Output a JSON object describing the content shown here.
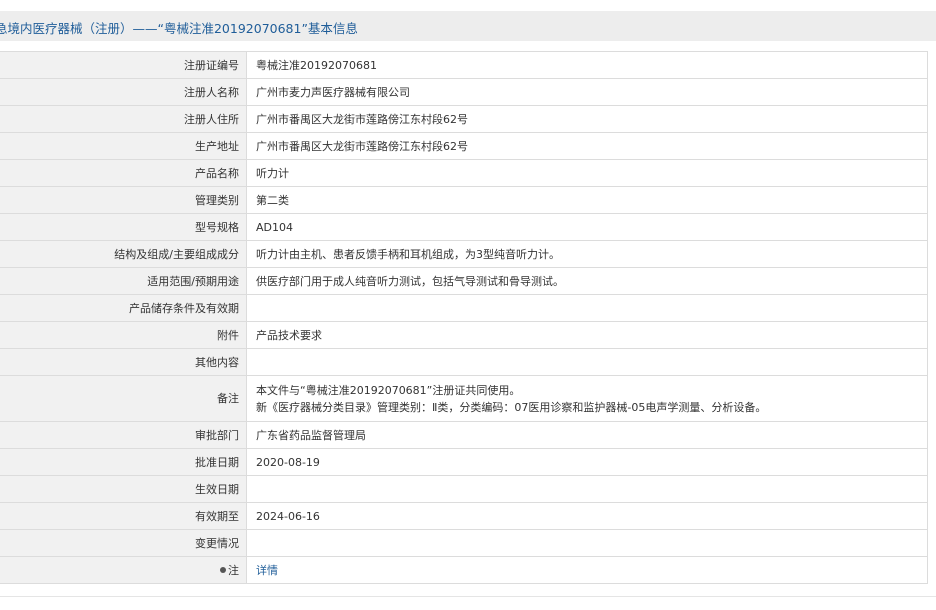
{
  "header": {
    "title": "急境内医疗器械（注册）——“粤械注准20192070681”基本信息"
  },
  "rows": [
    {
      "label": "注册证编号",
      "value": "粤械注准20192070681"
    },
    {
      "label": "注册人名称",
      "value": "广州市麦力声医疗器械有限公司"
    },
    {
      "label": "注册人住所",
      "value": "广州市番禺区大龙街市莲路傍江东村段62号"
    },
    {
      "label": "生产地址",
      "value": "广州市番禺区大龙街市莲路傍江东村段62号"
    },
    {
      "label": "产品名称",
      "value": "听力计"
    },
    {
      "label": "管理类别",
      "value": "第二类"
    },
    {
      "label": "型号规格",
      "value": "AD104"
    },
    {
      "label": "结构及组成/主要组成成分",
      "value": "听力计由主机、患者反馈手柄和耳机组成，为3型纯音听力计。"
    },
    {
      "label": "适用范围/预期用途",
      "value": "供医疗部门用于成人纯音听力测试，包括气导测试和骨导测试。"
    },
    {
      "label": "产品储存条件及有效期",
      "value": ""
    },
    {
      "label": "附件",
      "value": "产品技术要求"
    },
    {
      "label": "其他内容",
      "value": ""
    },
    {
      "label": "备注",
      "value_lines": [
        "本文件与“粤械注准20192070681”注册证共同使用。",
        "新《医疗器械分类目录》管理类别：Ⅱ类，分类编码：07医用诊察和监护器械-05电声学测量、分析设备。"
      ]
    },
    {
      "label": "审批部门",
      "value": "广东省药品监督管理局"
    },
    {
      "label": "批准日期",
      "value": "2020-08-19"
    },
    {
      "label": "生效日期",
      "value": ""
    },
    {
      "label": "有效期至",
      "value": "2024-06-16"
    },
    {
      "label": "变更情况",
      "value": ""
    },
    {
      "label": "注",
      "value": "详情",
      "label_icon": "pin-icon"
    }
  ],
  "colors": {
    "title": "#1f5d99",
    "link": "#1f5d99",
    "label_bg": "#f1f1f1",
    "header_bg": "#ededed",
    "border": "#dcdcdc"
  }
}
